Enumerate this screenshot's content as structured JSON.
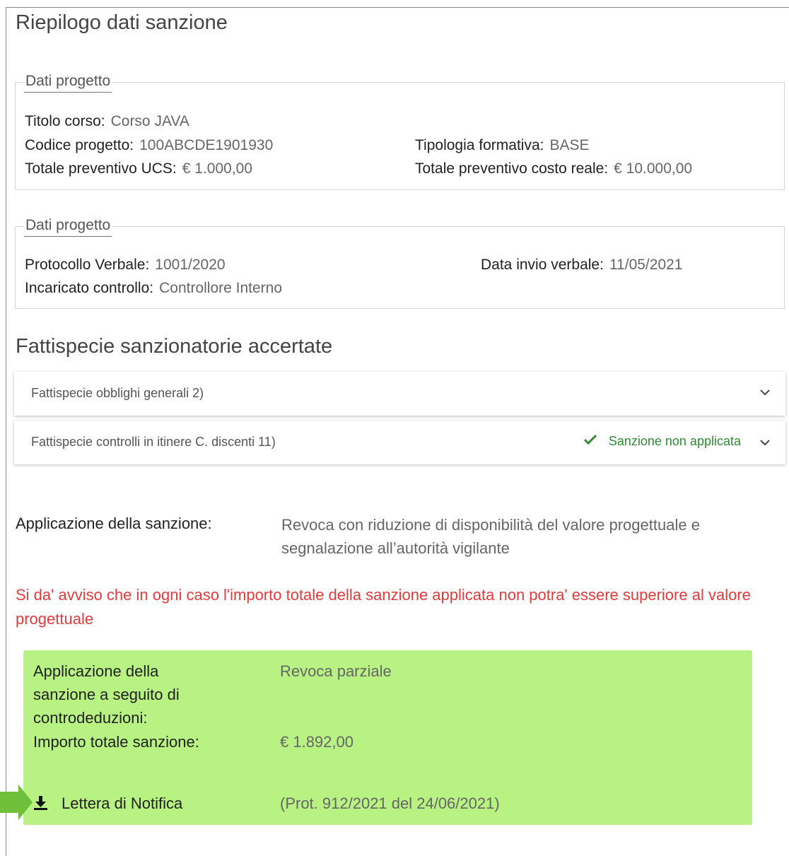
{
  "page_title": "Riepilogo dati sanzione",
  "project_box": {
    "legend": "Dati progetto",
    "titolo_corso_label": "Titolo corso:",
    "titolo_corso_value": "Corso JAVA",
    "codice_progetto_label": "Codice progetto:",
    "codice_progetto_value": "100ABCDE1901930",
    "tipologia_label": "Tipologia formativa:",
    "tipologia_value": "BASE",
    "totale_ucs_label": "Totale preventivo UCS:",
    "totale_ucs_value": "€ 1.000,00",
    "totale_reale_label": "Totale preventivo costo reale:",
    "totale_reale_value": "€ 10.000,00"
  },
  "verbale_box": {
    "legend": "Dati progetto",
    "protocollo_label": "Protocollo Verbale:",
    "protocollo_value": "1001/2020",
    "data_invio_label": "Data invio verbale:",
    "data_invio_value": "11/05/2021",
    "incaricato_label": "Incaricato controllo:",
    "incaricato_value": "Controllore Interno"
  },
  "fattispecie": {
    "title": "Fattispecie sanzionatorie accertate",
    "items": [
      {
        "label": "Fattispecie obblighi generali 2)",
        "status": ""
      },
      {
        "label": "Fattispecie controlli in itinere C. discenti 11)",
        "status": "Sanzione non applicata"
      }
    ]
  },
  "applicazione": {
    "label": "Applicazione della sanzione:",
    "value": "Revoca con riduzione di disponibilità del valore progettuale e segnalazione all’autorità vigilante"
  },
  "warning_text": "Si da' avviso che in ogni caso l'importo totale della sanzione applicata non potra' essere superiore al valore progettuale",
  "result_box": {
    "controdeduzioni_label_line1": "Applicazione della",
    "controdeduzioni_label_line2": "sanzione a seguito di",
    "controdeduzioni_label_line3": "controdeduzioni:",
    "controdeduzioni_value": "Revoca parziale",
    "importo_label": "Importo totale sanzione:",
    "importo_value": "€ 1.892,00",
    "lettera_label": "Lettera di Notifica",
    "lettera_prot": "(Prot. 912/2021 del 24/06/2021)"
  },
  "colors": {
    "success": "#2e8b34",
    "warning": "#e53a3a",
    "result_bg": "#b7f282",
    "pointer_arrow": "#6fbf3a"
  },
  "icons": {
    "status": "check-icon",
    "expand": "chevron-down-icon",
    "download": "download-icon",
    "pointer": "arrow-right-icon"
  }
}
